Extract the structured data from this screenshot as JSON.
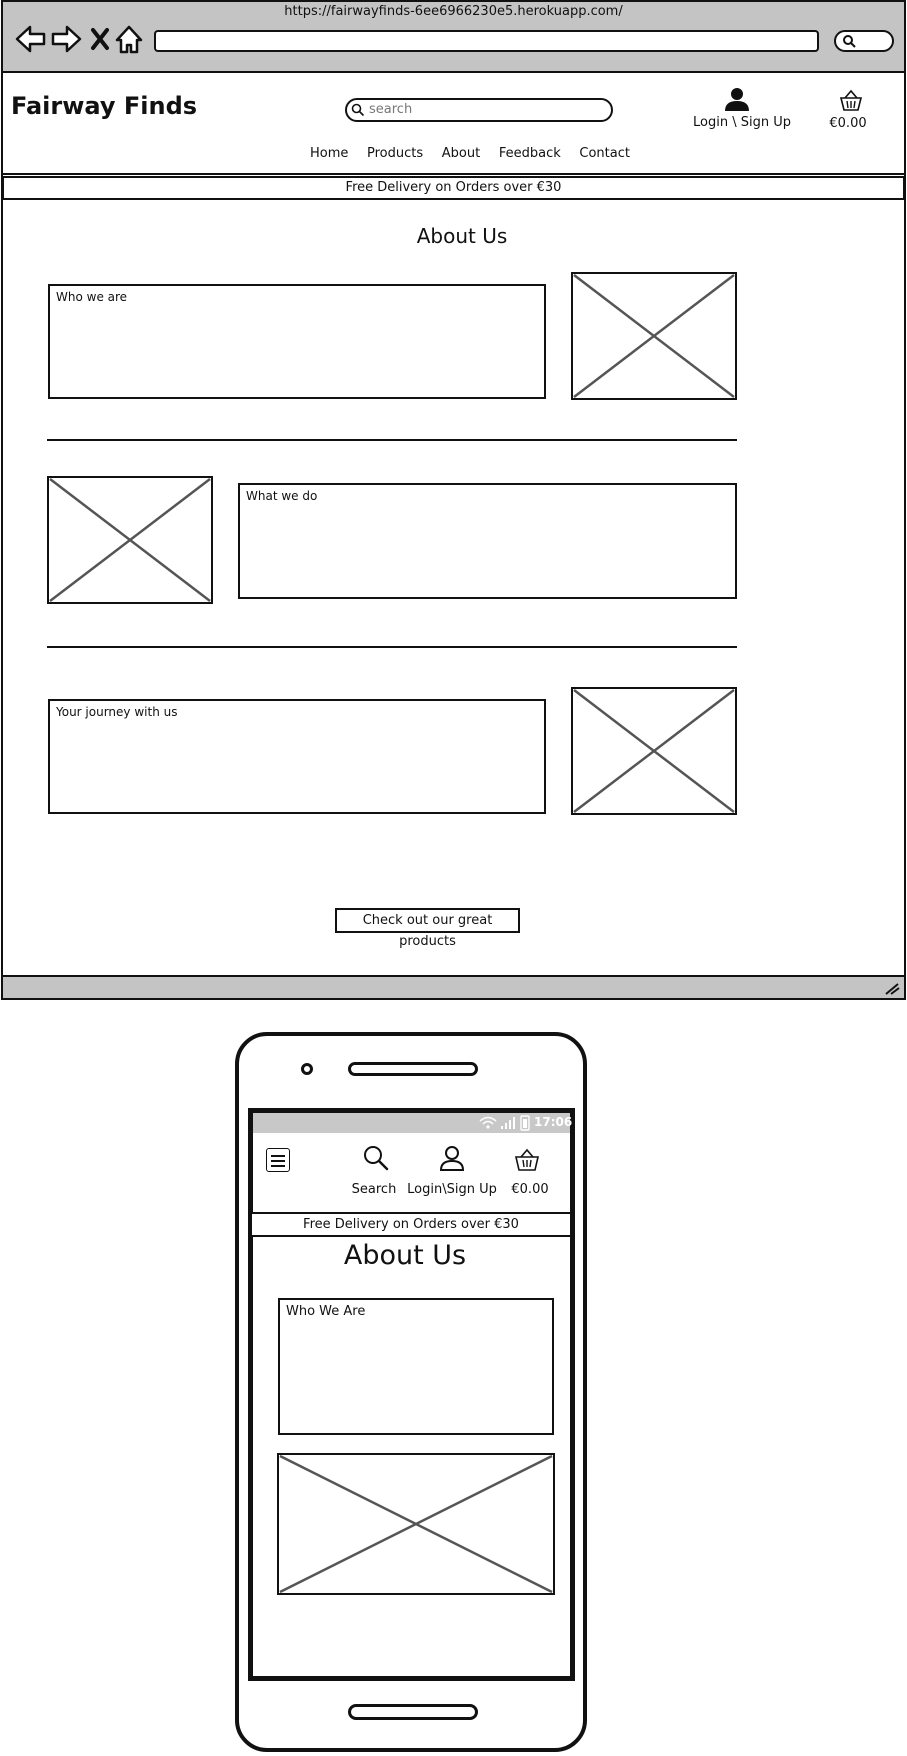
{
  "browser": {
    "url": "https://fairwayfinds-6ee6966230e5.herokuapp.com/"
  },
  "header": {
    "brand": "Fairway Finds",
    "search_placeholder": "search",
    "login_label": "Login \\ Sign Up",
    "basket_total": "€0.00",
    "nav": [
      "Home",
      "Products",
      "About",
      "Feedback",
      "Contact"
    ]
  },
  "banner": "Free Delivery on Orders over €30",
  "about": {
    "title": "About Us",
    "sections": [
      {
        "label": "Who we are"
      },
      {
        "label": "What we do"
      },
      {
        "label": "Your journey with us"
      }
    ],
    "cta_label": "Check out our great products"
  },
  "mobile": {
    "status_time": "17:06",
    "search_label": "Search",
    "login_label": "Login\\Sign Up",
    "basket_total": "€0.00",
    "banner": "Free Delivery on Orders over €30",
    "title": "About Us",
    "section_label": "Who We Are"
  }
}
